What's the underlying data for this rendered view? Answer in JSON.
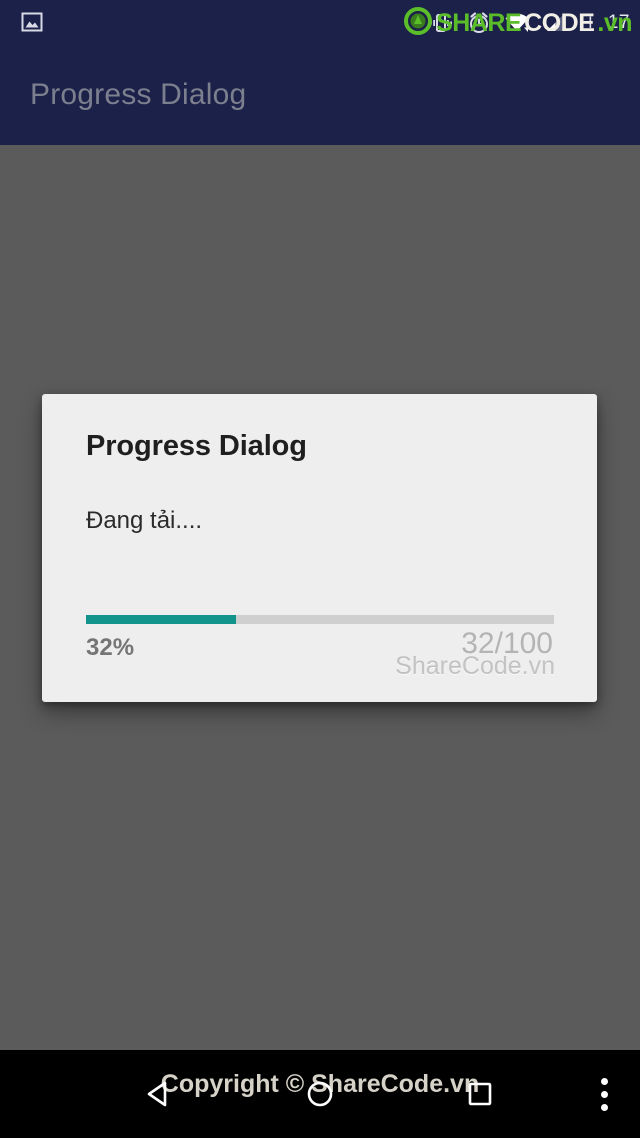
{
  "status_bar": {
    "left_icon": "photo-icon",
    "icons": [
      "vibrate-icon",
      "alarm-icon",
      "wifi-icon",
      "signal-icon"
    ],
    "network_type": "H",
    "clock": "17"
  },
  "brand_watermark": {
    "logo": "sharecode-logo-icon",
    "part1": "SHARE",
    "part2": "CODE",
    "part3": ".vn"
  },
  "app_bar": {
    "title": "Progress Dialog"
  },
  "dialog": {
    "title": "Progress Dialog",
    "message": "Đang tải....",
    "percent_label": "32%",
    "count_label": "32/100",
    "watermark": "ShareCode.vn",
    "progress_value": 32,
    "progress_max": 100,
    "fill_color": "#12938c",
    "track_color": "#cfcfcf",
    "background_color": "#eeeeee"
  },
  "nav_bar": {
    "back": "back-button",
    "home": "home-button",
    "recent": "recent-apps-button",
    "overflow": "overflow-menu-button",
    "watermark": "Copyright © ShareCode.vn"
  },
  "colors": {
    "app_bar": "#1b2149",
    "status_bar": "#1b2148",
    "scrim": "#5b5b5b",
    "accent": "#12938c",
    "nav_bar": "#000000"
  }
}
